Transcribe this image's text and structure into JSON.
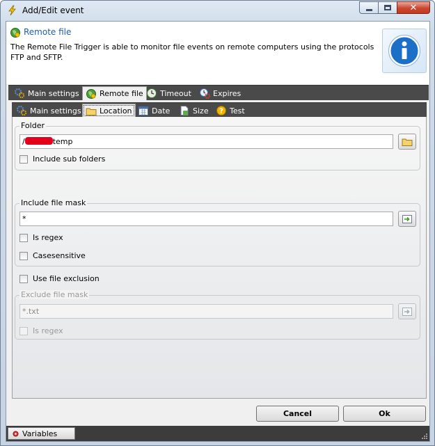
{
  "window": {
    "title": "Add/Edit event"
  },
  "header": {
    "title": "Remote file",
    "description": "The Remote File Trigger is able to monitor file events on remote computers using the protocols FTP and SFTP."
  },
  "main_tabs": [
    {
      "label": "Main settings",
      "icon": "gear-icon",
      "active": false
    },
    {
      "label": "Remote file",
      "icon": "globe-icon",
      "active": true
    },
    {
      "label": "Timeout",
      "icon": "clock-icon",
      "active": false
    },
    {
      "label": "Expires",
      "icon": "clock-gear-icon",
      "active": false
    }
  ],
  "sub_tabs": [
    {
      "label": "Main settings",
      "icon": "gear-icon",
      "active": false
    },
    {
      "label": "Location",
      "icon": "folder-icon",
      "active": true
    },
    {
      "label": "Date",
      "icon": "calendar-icon",
      "active": false
    },
    {
      "label": "Size",
      "icon": "document-icon",
      "active": false
    },
    {
      "label": "Test",
      "icon": "help-icon",
      "active": false
    }
  ],
  "folder": {
    "label": "Folder",
    "value_prefix": "/",
    "value_suffix": "temp",
    "include_sub_folders": {
      "label": "Include sub folders",
      "checked": false
    }
  },
  "include_mask": {
    "label": "Include file mask",
    "value": "*",
    "is_regex": {
      "label": "Is regex",
      "checked": false
    },
    "case_sensitive": {
      "label": "Casesensitive",
      "checked": false
    }
  },
  "use_exclusion": {
    "label": "Use file exclusion",
    "checked": false
  },
  "exclude_mask": {
    "label": "Exclude file mask",
    "value": "*.txt",
    "is_regex": {
      "label": "Is regex",
      "checked": false
    }
  },
  "buttons": {
    "cancel": "Cancel",
    "ok": "Ok"
  },
  "bottom": {
    "variables": "Variables"
  },
  "colors": {
    "accent": "#1f5ea8",
    "tabbar": "#4a4a4a",
    "close": "#c9462f"
  }
}
